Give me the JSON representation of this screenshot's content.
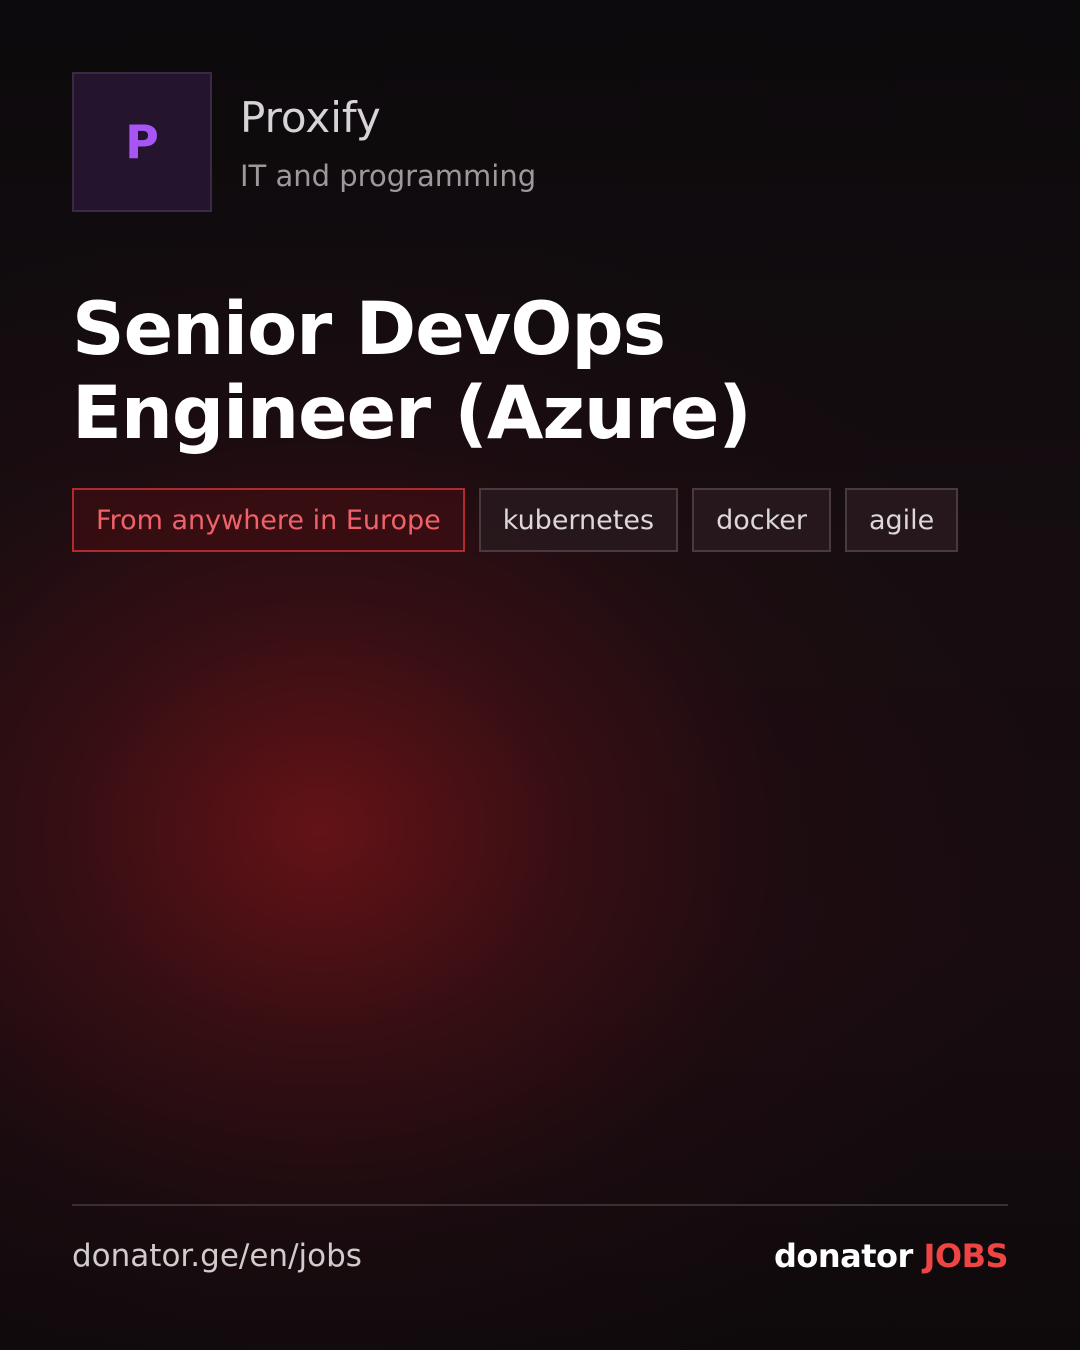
{
  "company": {
    "logo_letter": "P",
    "name": "Proxify",
    "category": "IT and programming"
  },
  "job": {
    "title": "Senior DevOps Engineer (Azure)"
  },
  "tags": {
    "location": "From anywhere in Europe",
    "skills": [
      "kubernetes",
      "docker",
      "agile"
    ]
  },
  "footer": {
    "url": "donator.ge/en/jobs",
    "brand_main": "donator",
    "brand_accent": "JOBS"
  },
  "colors": {
    "logo_accent": "#a855f7",
    "location_tag": "#f0616a",
    "brand_accent": "#ef4444"
  }
}
